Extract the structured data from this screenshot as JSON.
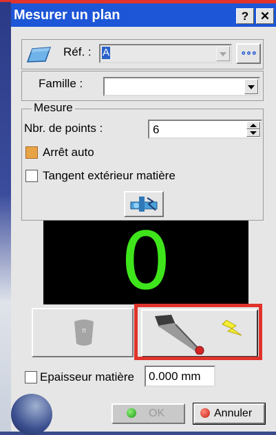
{
  "window": {
    "title": "Mesurer un plan",
    "help_label": "?",
    "close_label": "✕"
  },
  "ref": {
    "label": "Réf. :",
    "value": "A",
    "browse_label": "∘∘∘"
  },
  "famille": {
    "label": "Famille :",
    "value": ""
  },
  "mesure": {
    "group_label": "Mesure",
    "points_label": "Nbr. de points :",
    "points_value": "6",
    "arret_auto_label": "Arrêt auto",
    "arret_auto_checked": true,
    "tangent_label": "Tangent extérieur matière",
    "tangent_checked": false
  },
  "display": {
    "value": "0"
  },
  "epaisseur": {
    "label": "Epaisseur matière",
    "value": "0.000 mm",
    "checked": false
  },
  "footer": {
    "ok_label": "OK",
    "cancel_label": "Annuler"
  },
  "colors": {
    "titlebar": "#1d56d6",
    "digit": "#3fe51b",
    "highlight_frame": "#e0332b"
  }
}
